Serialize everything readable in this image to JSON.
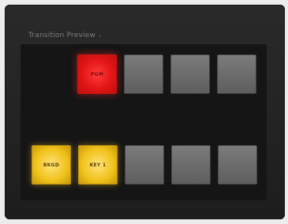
{
  "panel": {
    "title": "Transition Preview",
    "title_icon": "chevron-right-icon"
  },
  "rows": {
    "top": [
      {
        "label": "PGM",
        "state": "active-red"
      },
      {
        "label": "",
        "state": "off"
      },
      {
        "label": "",
        "state": "off"
      },
      {
        "label": "",
        "state": "off"
      }
    ],
    "bottom": [
      {
        "label": "BKGD",
        "state": "active-yellow"
      },
      {
        "label": "KEY 1",
        "state": "active-yellow"
      },
      {
        "label": "",
        "state": "off"
      },
      {
        "label": "",
        "state": "off"
      },
      {
        "label": "",
        "state": "off"
      }
    ]
  },
  "colors": {
    "panel_bg": "#1d1d1d",
    "active_red": "#e31616",
    "active_yellow": "#f0c21a",
    "inactive": "#6a6a6a"
  }
}
